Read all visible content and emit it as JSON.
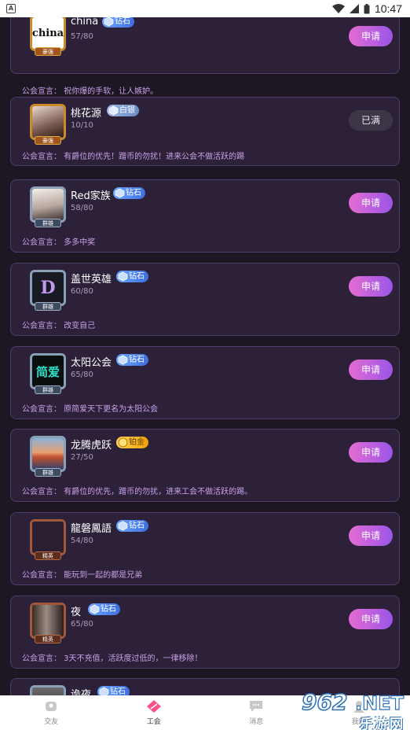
{
  "status_bar": {
    "app_icon_letter": "A",
    "time": "10:47"
  },
  "guilds": [
    {
      "name": "china",
      "level": "钻石",
      "level_type": "diamond",
      "members": "57/80",
      "rank": "豪强",
      "rank_type": "gold",
      "avatar_text": "china",
      "action": "申请",
      "declaration": "公会宣言：  祝你爆的手软，让人嫉妒。"
    },
    {
      "name": "桃花源",
      "level": "白银",
      "level_type": "silver",
      "members": "10/10",
      "rank": "豪强",
      "rank_type": "gold",
      "avatar_text": "",
      "action": "已满",
      "declaration": "公会宣言：  有爵位的优先！蹭币的勿扰！进来公会不做活跃的踢"
    },
    {
      "name": "Red家族",
      "level": "钻石",
      "level_type": "diamond",
      "members": "58/80",
      "rank": "群雄",
      "rank_type": "silver",
      "avatar_text": "",
      "action": "申请",
      "declaration": "公会宣言：  多多中奖"
    },
    {
      "name": "盖世英雄",
      "level": "钻石",
      "level_type": "diamond",
      "members": "60/80",
      "rank": "群雄",
      "rank_type": "silver",
      "avatar_text": "D",
      "action": "申请",
      "declaration": "公会宣言：  改变自己"
    },
    {
      "name": "太阳公会",
      "level": "钻石",
      "level_type": "diamond",
      "members": "65/80",
      "rank": "群雄",
      "rank_type": "silver",
      "avatar_text": "简爱",
      "action": "申请",
      "declaration": "公会宣言：  原简爱天下更名为太阳公会"
    },
    {
      "name": "龙腾虎跃",
      "level": "铂金",
      "level_type": "gold",
      "members": "27/50",
      "rank": "群雄",
      "rank_type": "silver",
      "avatar_text": "",
      "action": "申请",
      "declaration": "公会宣言：  有爵位的优先，蹭币的勿扰，进来工会不做活跃的踢。"
    },
    {
      "name": "龍磐鳳語",
      "level": "钻石",
      "level_type": "diamond",
      "members": "54/80",
      "rank": "精英",
      "rank_type": "bronze",
      "avatar_text": "",
      "action": "申请",
      "declaration": "公会宣言：  能玩到一起的都是兄弟"
    },
    {
      "name": "夜",
      "level": "钻石",
      "level_type": "diamond",
      "members": "65/80",
      "rank": "精英",
      "rank_type": "bronze",
      "avatar_text": "",
      "action": "申请",
      "declaration": "公会宣言：  3天不充值，活跃度过低的，一律移除！"
    },
    {
      "name": "诡夜",
      "level": "钻石",
      "level_type": "diamond",
      "members": "",
      "rank": "",
      "rank_type": "bronze",
      "avatar_text": "",
      "action": "申请",
      "declaration": ""
    }
  ],
  "bottom_nav": {
    "items": [
      {
        "label": "交友",
        "icon": "friends-icon",
        "active": false
      },
      {
        "label": "工会",
        "icon": "guild-icon",
        "active": true
      },
      {
        "label": "消息",
        "icon": "message-icon",
        "active": false
      },
      {
        "label": "我的",
        "icon": "profile-icon",
        "active": false
      }
    ]
  },
  "watermark": {
    "number": "962",
    "suffix": ".NET",
    "text": "乐游网"
  },
  "colors": {
    "card_bg": "#2c2139",
    "card_border": "#4e3d6a",
    "apply_button_gradient_start": "#e56cd2",
    "apply_button_gradient_end": "#9a55e8",
    "declaration_text": "#c9a1e8"
  }
}
